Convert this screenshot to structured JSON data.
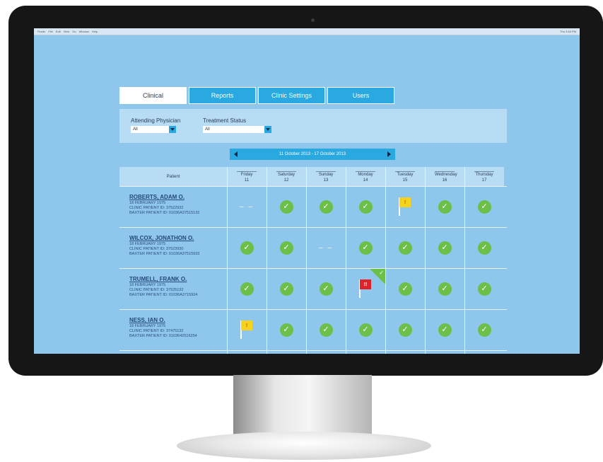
{
  "menubar": {
    "items": [
      "Finder",
      "File",
      "Edit",
      "View",
      "Go",
      "Window",
      "Help"
    ],
    "status": "Thu 3:45 PM"
  },
  "tabs": [
    {
      "label": "Clinical",
      "active": true
    },
    {
      "label": "Reports",
      "active": false
    },
    {
      "label": "Clinic Settings",
      "active": false
    },
    {
      "label": "Users",
      "active": false
    }
  ],
  "filters": {
    "physician": {
      "label": "Attending Physician",
      "value": "All"
    },
    "status": {
      "label": "Treatment Status",
      "value": "All"
    }
  },
  "date_range": "11 October 2013 - 17 October 2013",
  "grid": {
    "patient_header": "Patient",
    "days": [
      {
        "name": "Friday",
        "date": "11"
      },
      {
        "name": "Saturday",
        "date": "12"
      },
      {
        "name": "Sunday",
        "date": "13"
      },
      {
        "name": "Monday",
        "date": "14"
      },
      {
        "name": "Tuesday",
        "date": "15"
      },
      {
        "name": "Wednesday",
        "date": "16"
      },
      {
        "name": "Thursday",
        "date": "17"
      }
    ],
    "patients": [
      {
        "name": "ROBERTS, ADAM O.",
        "dob": "18 FEBRUARY 1975",
        "clinic_id": "CLINIC PATIENT ID: 37522932",
        "baxter_id": "BAXTER PATIENT ID: 01036A37515132",
        "statuses": [
          "none",
          "check",
          "check",
          "check",
          "flag-yellow",
          "check",
          "check"
        ]
      },
      {
        "name": "WILCOX, JONATHON O.",
        "dob": "18 FEBRUARY 1975",
        "clinic_id": "CLINIC PATIENT ID: 37523930",
        "baxter_id": "BAXTER PATIENT ID: 01036A37515933",
        "statuses": [
          "check",
          "check",
          "none",
          "check",
          "check",
          "check",
          "check"
        ]
      },
      {
        "name": "TRUMELL, FRANK O.",
        "dob": "18 FEBRUARY 1975",
        "clinic_id": "CLINIC PATIENT ID: 37525132",
        "baxter_id": "BAXTER PATIENT ID: 01036A3715934",
        "statuses": [
          "check",
          "check",
          "check",
          "flag-red-reviewed",
          "check",
          "check",
          "check"
        ]
      },
      {
        "name": "NESS, IAN O.",
        "dob": "18 FEBRUARY 1975",
        "clinic_id": "CLINIC PATIENT ID: 37475132",
        "baxter_id": "BAXTER PATIENT ID: 0103642516254",
        "statuses": [
          "flag-yellow",
          "check",
          "check",
          "check",
          "check",
          "check",
          "check"
        ]
      }
    ]
  },
  "icons": {
    "check": "✓",
    "dash": "– –",
    "flag_yellow": "!",
    "flag_red": "!!"
  },
  "colors": {
    "screen_bg": "#8ec6ec",
    "accent": "#29a9df",
    "check": "#6cc04a",
    "flag_yellow": "#f5d21b",
    "flag_red": "#e0232a"
  }
}
